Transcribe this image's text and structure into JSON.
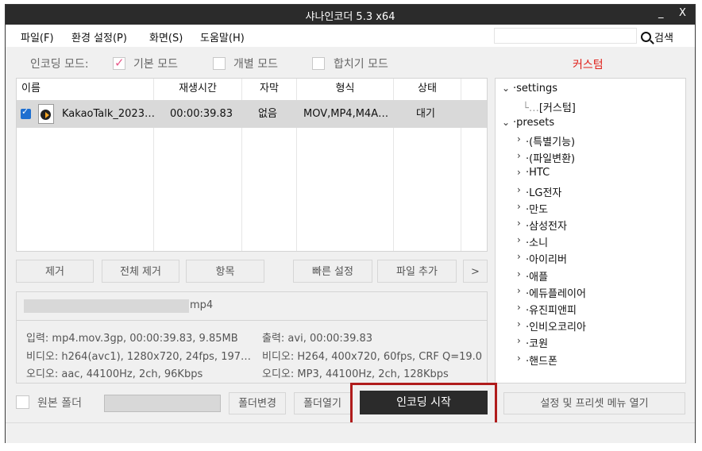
{
  "window": {
    "title": "샤나인코더  5.3  x64",
    "minimize": "_",
    "close": "X"
  },
  "menu": {
    "file": "파일(F)",
    "settings": "환경 설정(P)",
    "view": "화면(S)",
    "help": "도움말(H)",
    "search_value": "",
    "search_label": "검색"
  },
  "mode": {
    "label": "인코딩 모드:",
    "basic": "기본 모드",
    "individual": "개별 모드",
    "merge": "합치기 모드",
    "custom_link": "커스텀",
    "basic_checked": true,
    "individual_checked": false,
    "merge_checked": false
  },
  "table": {
    "headers": [
      "이름",
      "재생시간",
      "자막",
      "형식",
      "상태"
    ],
    "rows": [
      {
        "checked": true,
        "name": "KakaoTalk_2023…",
        "duration": "00:00:39.83",
        "subtitle": "없음",
        "format": "MOV,MP4,M4A…",
        "status": "대기"
      }
    ]
  },
  "actions": {
    "remove": "제거",
    "remove_all": "전체 제거",
    "item": "항목",
    "quick_settings": "빠른 설정",
    "add_file": "파일 추가",
    "more": ">"
  },
  "info": {
    "filename_ext": "mp4",
    "input": "입력: mp4.mov.3gp, 00:00:39.83, 9.85MB",
    "input_video": "비디오: h264(avc1), 1280x720, 24fps, 197…",
    "input_audio": "오디오: aac, 44100Hz, 2ch, 96Kbps",
    "output": "출력: avi, 00:00:39.83",
    "output_video": "비디오: H264, 400x720, 60fps, CRF Q=19.0",
    "output_audio": "오디오: MP3, 44100Hz, 2ch, 128Kbps"
  },
  "tree": {
    "settings": "settings",
    "custom": "[커스텀]",
    "presets": "presets",
    "children": [
      "(특별기능)",
      "(파일변환)",
      "HTC",
      "LG전자",
      "만도",
      "삼성전자",
      "소니",
      "아이리버",
      "애플",
      "에듀플레이어",
      "유진피앤피",
      "인비오코리아",
      "코원",
      "핸드폰"
    ]
  },
  "bottom": {
    "source_folder": "원본 폴더",
    "source_folder_checked": false,
    "change_folder": "폴더변경",
    "open_folder": "폴더열기",
    "start_encoding": "인코딩 시작",
    "open_settings_menu": "설정 및 프리셋 메뉴 열기"
  }
}
